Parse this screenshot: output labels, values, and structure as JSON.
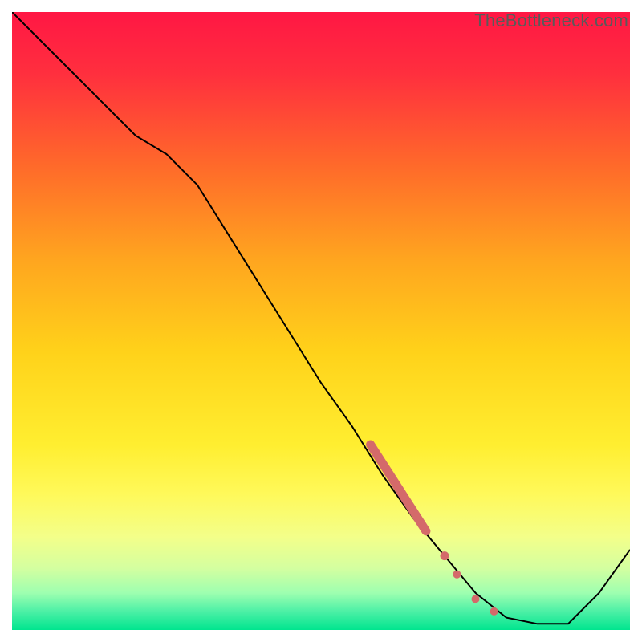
{
  "watermark": "TheBottleneck.com",
  "chart_data": {
    "type": "line",
    "title": "",
    "xlabel": "",
    "ylabel": "",
    "xlim": [
      0,
      100
    ],
    "ylim": [
      0,
      100
    ],
    "series": [
      {
        "name": "bottleneck-curve",
        "x": [
          0,
          5,
          10,
          15,
          20,
          25,
          30,
          35,
          40,
          45,
          50,
          55,
          60,
          65,
          70,
          75,
          80,
          85,
          90,
          95,
          100
        ],
        "y": [
          100,
          95,
          90,
          85,
          80,
          77,
          72,
          64,
          56,
          48,
          40,
          33,
          25,
          18,
          12,
          6,
          2,
          1,
          1,
          6,
          13
        ],
        "color": "#000000"
      }
    ],
    "highlight_segment": {
      "name": "highlight-band",
      "color": "#d46a6a",
      "points": [
        {
          "x": 58,
          "y": 30
        },
        {
          "x": 67,
          "y": 16
        }
      ],
      "dots": [
        {
          "x": 70,
          "y": 12
        },
        {
          "x": 72,
          "y": 9
        },
        {
          "x": 75,
          "y": 5
        },
        {
          "x": 78,
          "y": 3
        }
      ]
    },
    "background_gradient": {
      "stops": [
        {
          "offset": 0.0,
          "color": "#ff1744"
        },
        {
          "offset": 0.1,
          "color": "#ff2f3e"
        },
        {
          "offset": 0.25,
          "color": "#ff6a2a"
        },
        {
          "offset": 0.4,
          "color": "#ffa51f"
        },
        {
          "offset": 0.55,
          "color": "#ffd21a"
        },
        {
          "offset": 0.7,
          "color": "#ffee30"
        },
        {
          "offset": 0.78,
          "color": "#fff95a"
        },
        {
          "offset": 0.85,
          "color": "#f3ff8a"
        },
        {
          "offset": 0.9,
          "color": "#d4ffa0"
        },
        {
          "offset": 0.94,
          "color": "#9effb0"
        },
        {
          "offset": 0.97,
          "color": "#4cf0a6"
        },
        {
          "offset": 1.0,
          "color": "#00e58f"
        }
      ]
    }
  }
}
